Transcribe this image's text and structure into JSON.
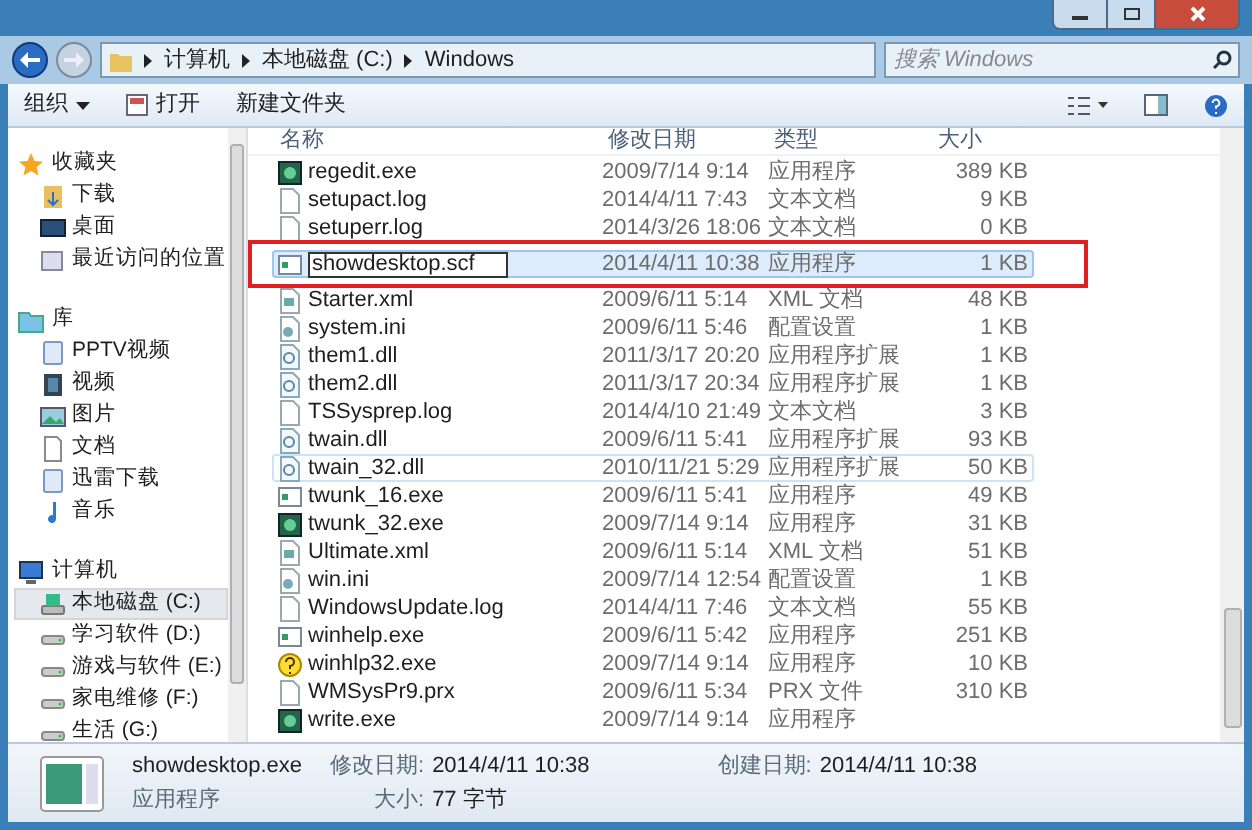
{
  "address_bar": {
    "crumbs": [
      "计算机",
      "本地磁盘 (C:)",
      "Windows"
    ]
  },
  "search": {
    "placeholder": "搜索 Windows"
  },
  "toolbar": {
    "buttons": [
      {
        "label": "组织",
        "kind": "menu"
      },
      {
        "label": "打开",
        "kind": "icon"
      },
      {
        "label": "新建文件夹",
        "kind": "plain"
      }
    ]
  },
  "sidebar": {
    "groups": [
      {
        "label": "收藏夹",
        "kind": "star",
        "items": [
          {
            "label": "下载",
            "kind": "download",
            "selected": false
          },
          {
            "label": "桌面",
            "kind": "desktop",
            "selected": false
          },
          {
            "label": "最近访问的位置",
            "kind": "recent",
            "selected": false
          }
        ]
      },
      {
        "label": "库",
        "kind": "library",
        "items": [
          {
            "label": "PPTV视频",
            "kind": "lib",
            "selected": false
          },
          {
            "label": "视频",
            "kind": "video",
            "selected": false
          },
          {
            "label": "图片",
            "kind": "picture",
            "selected": false
          },
          {
            "label": "文档",
            "kind": "doc",
            "selected": false
          },
          {
            "label": "迅雷下载",
            "kind": "lib",
            "selected": false
          },
          {
            "label": "音乐",
            "kind": "music",
            "selected": false
          }
        ]
      },
      {
        "label": "计算机",
        "kind": "computer",
        "items": [
          {
            "label": "本地磁盘 (C:)",
            "kind": "sysdrive",
            "selected": true
          },
          {
            "label": "学习软件 (D:)",
            "kind": "drive",
            "selected": false
          },
          {
            "label": "游戏与软件 (E:)",
            "kind": "drive",
            "selected": false
          },
          {
            "label": "家电维修 (F:)",
            "kind": "drive",
            "selected": false
          },
          {
            "label": "生活 (G:)",
            "kind": "drive",
            "selected": false
          }
        ]
      }
    ]
  },
  "table": {
    "columns": [
      "名称",
      "修改日期",
      "类型",
      "大小"
    ],
    "rows": [
      {
        "name": "regedit.exe",
        "date": "2009/7/14 9:14",
        "type": "应用程序",
        "size": "389 KB",
        "kind": "exe",
        "selected": false,
        "hovered": false,
        "renaming": false
      },
      {
        "name": "setupact.log",
        "date": "2014/4/11 7:43",
        "type": "文本文档",
        "size": "9 KB",
        "kind": "text",
        "selected": false,
        "hovered": false,
        "renaming": false
      },
      {
        "name": "setuperr.log",
        "date": "2014/3/26 18:06",
        "type": "文本文档",
        "size": "0 KB",
        "kind": "text",
        "selected": false,
        "hovered": false,
        "renaming": false
      },
      {
        "name": "showdesktop.scf",
        "date": "2014/4/11 10:38",
        "type": "应用程序",
        "size": "1 KB",
        "kind": "app",
        "selected": true,
        "hovered": false,
        "renaming": true
      },
      {
        "name": "Starter.xml",
        "date": "2009/6/11 5:14",
        "type": "XML 文档",
        "size": "48 KB",
        "kind": "xml",
        "selected": false,
        "hovered": false,
        "renaming": false
      },
      {
        "name": "system.ini",
        "date": "2009/6/11 5:46",
        "type": "配置设置",
        "size": "1 KB",
        "kind": "ini",
        "selected": false,
        "hovered": false,
        "renaming": false
      },
      {
        "name": "them1.dll",
        "date": "2011/3/17 20:20",
        "type": "应用程序扩展",
        "size": "1 KB",
        "kind": "dll",
        "selected": false,
        "hovered": false,
        "renaming": false
      },
      {
        "name": "them2.dll",
        "date": "2011/3/17 20:34",
        "type": "应用程序扩展",
        "size": "1 KB",
        "kind": "dll",
        "selected": false,
        "hovered": false,
        "renaming": false
      },
      {
        "name": "TSSysprep.log",
        "date": "2014/4/10 21:49",
        "type": "文本文档",
        "size": "3 KB",
        "kind": "text",
        "selected": false,
        "hovered": false,
        "renaming": false
      },
      {
        "name": "twain.dll",
        "date": "2009/6/11 5:41",
        "type": "应用程序扩展",
        "size": "93 KB",
        "kind": "dll",
        "selected": false,
        "hovered": false,
        "renaming": false
      },
      {
        "name": "twain_32.dll",
        "date": "2010/11/21 5:29",
        "type": "应用程序扩展",
        "size": "50 KB",
        "kind": "dll",
        "selected": false,
        "hovered": true,
        "renaming": false
      },
      {
        "name": "twunk_16.exe",
        "date": "2009/6/11 5:41",
        "type": "应用程序",
        "size": "49 KB",
        "kind": "app",
        "selected": false,
        "hovered": false,
        "renaming": false
      },
      {
        "name": "twunk_32.exe",
        "date": "2009/7/14 9:14",
        "type": "应用程序",
        "size": "31 KB",
        "kind": "exe",
        "selected": false,
        "hovered": false,
        "renaming": false
      },
      {
        "name": "Ultimate.xml",
        "date": "2009/6/11 5:14",
        "type": "XML 文档",
        "size": "51 KB",
        "kind": "xml",
        "selected": false,
        "hovered": false,
        "renaming": false
      },
      {
        "name": "win.ini",
        "date": "2009/7/14 12:54",
        "type": "配置设置",
        "size": "1 KB",
        "kind": "ini",
        "selected": false,
        "hovered": false,
        "renaming": false
      },
      {
        "name": "WindowsUpdate.log",
        "date": "2014/4/11 7:46",
        "type": "文本文档",
        "size": "55 KB",
        "kind": "text",
        "selected": false,
        "hovered": false,
        "renaming": false
      },
      {
        "name": "winhelp.exe",
        "date": "2009/6/11 5:42",
        "type": "应用程序",
        "size": "251 KB",
        "kind": "app",
        "selected": false,
        "hovered": false,
        "renaming": false
      },
      {
        "name": "winhlp32.exe",
        "date": "2009/7/14 9:14",
        "type": "应用程序",
        "size": "10 KB",
        "kind": "help",
        "selected": false,
        "hovered": false,
        "renaming": false
      },
      {
        "name": "WMSysPr9.prx",
        "date": "2009/6/11 5:34",
        "type": "PRX 文件",
        "size": "310 KB",
        "kind": "text",
        "selected": false,
        "hovered": false,
        "renaming": false
      },
      {
        "name": "write.exe",
        "date": "2009/7/14 9:14",
        "type": "应用程序",
        "kind": "exe",
        "selected": false,
        "hovered": false,
        "renaming": false
      }
    ]
  },
  "details": {
    "name": "showdesktop.exe",
    "type": "应用程序",
    "fields": [
      {
        "label": "修改日期:",
        "value": "2014/4/11 10:38"
      },
      {
        "label": "创建日期:",
        "value": "2014/4/11 10:38"
      },
      {
        "label": "大小:",
        "value": "77 字节"
      }
    ]
  }
}
